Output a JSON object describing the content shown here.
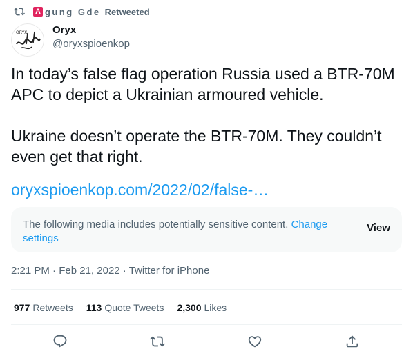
{
  "retweet": {
    "icon": "retweet-icon",
    "chip_letter": "A",
    "retweeter_name": "gung Gde",
    "label": "Retweeted"
  },
  "author": {
    "avatar_icon": "oryx-avatar",
    "avatar_text": "ORYX",
    "name": "Oryx",
    "handle": "@oryxspioenkop"
  },
  "tweet": {
    "text": "In today’s false flag operation Russia used a BTR-70M APC to depict a Ukrainian armoured vehicle.\n\nUkraine doesn’t operate the BTR-70M. They couldn’t even get that right.",
    "link": "oryxspioenkop.com/2022/02/false-…"
  },
  "sensitive": {
    "message": "The following media includes potentially sensitive content.",
    "change_label": "Change settings",
    "view_label": "View"
  },
  "meta": {
    "time": "2:21 PM",
    "date": "Feb 21, 2022",
    "source": "Twitter for iPhone",
    "separator": "·"
  },
  "stats": {
    "retweets_count": "977",
    "retweets_label": "Retweets",
    "quotes_count": "113",
    "quotes_label": "Quote Tweets",
    "likes_count": "2,300",
    "likes_label": "Likes"
  },
  "actions": [
    "reply-icon",
    "retweet-icon",
    "like-icon",
    "share-icon"
  ],
  "colors": {
    "accent": "#1d9bf0",
    "secondary_text": "#536471",
    "primary_text": "#0f1419",
    "chip": "#e0245e"
  }
}
